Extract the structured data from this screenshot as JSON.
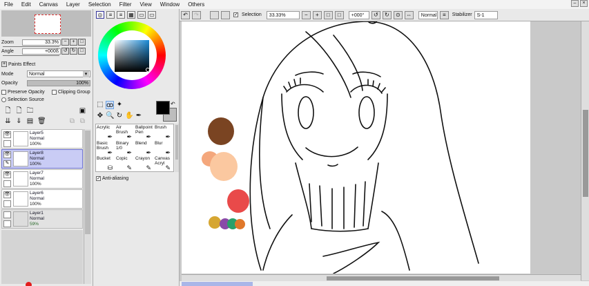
{
  "menu": [
    "File",
    "Edit",
    "Canvas",
    "Layer",
    "Selection",
    "Filter",
    "View",
    "Window",
    "Others"
  ],
  "left": {
    "zoom_label": "Zoom",
    "zoom_value": "33.3%",
    "angle_label": "Angle",
    "angle_value": "+000ß",
    "paints_effect": "Paints Effect",
    "mode_label": "Mode",
    "mode_value": "Normal",
    "opacity_label": "Opacity",
    "opacity_value": "100%",
    "preserve_opacity": "Preserve Opacity",
    "clipping_group": "Clipping Group",
    "selection_source": "Selection Source"
  },
  "layers": [
    {
      "name": "Layer5",
      "mode": "Normal",
      "opacity": "100%",
      "selected": false
    },
    {
      "name": "Layer8",
      "mode": "Normal",
      "opacity": "100%",
      "selected": true
    },
    {
      "name": "Layer7",
      "mode": "Normal",
      "opacity": "100%",
      "selected": false
    },
    {
      "name": "Layer6",
      "mode": "Normal",
      "opacity": "100%",
      "selected": false
    },
    {
      "name": "Layer1",
      "mode": "Normal",
      "opacity": "59%",
      "selected": false
    }
  ],
  "brushes": {
    "row1": [
      "Acrylic",
      "Air Brush",
      "Ballpoint Pen",
      "Brush"
    ],
    "row2": [
      "Basic Brush",
      "Binary 1/0",
      "Blend",
      "Blur"
    ],
    "row3": [
      "Bucket",
      "Copic",
      "Crayon",
      "Canvas Acryl"
    ]
  },
  "anti_aliasing": "Anti-aliasing",
  "toolbar": {
    "selection": "Selection",
    "zoom": "33.33%",
    "angle": "+000°",
    "blend_mode": "Normal",
    "stabilizer_label": "Stabilizer",
    "stabilizer_value": "S-1"
  },
  "colors": {
    "accent_selected_layer": "#c9ccf5",
    "paint_brown": "#7a4422",
    "paint_peach": "#f4a77c",
    "paint_light_peach": "#fbc8a0",
    "paint_red": "#e94a4a",
    "paint_yellow": "#d6a632",
    "paint_purple": "#8a4aa8",
    "paint_green": "#2aa06a",
    "paint_orange": "#e0782a"
  }
}
